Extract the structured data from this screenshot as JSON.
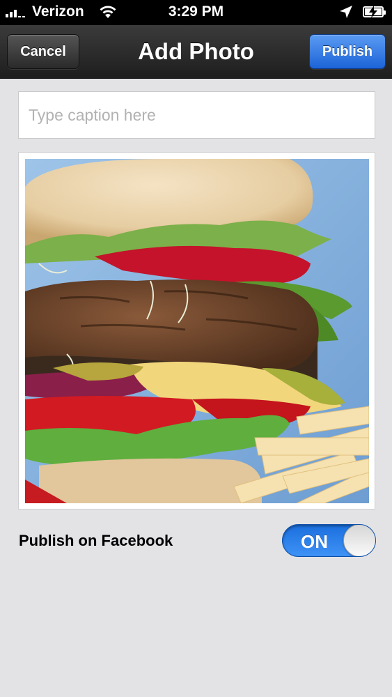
{
  "status_bar": {
    "carrier": "Verizon",
    "time": "3:29 PM",
    "signal_bars_filled": 3,
    "signal_bars_total": 5,
    "wifi_icon": "wifi-icon",
    "location_icon": "location-arrow-icon",
    "battery_icon": "battery-charging-icon"
  },
  "navbar": {
    "title": "Add Photo",
    "cancel_label": "Cancel",
    "publish_label": "Publish"
  },
  "caption": {
    "placeholder": "Type caption here",
    "value": ""
  },
  "photo": {
    "subject": "burger-with-fries-photo"
  },
  "facebook": {
    "label": "Publish on Facebook",
    "toggle_state": "ON"
  },
  "colors": {
    "accent_blue": "#1c64d8",
    "toggle_on": "#2a7ee8",
    "background": "#e3e3e6",
    "navbar": "#2b2b2b"
  }
}
